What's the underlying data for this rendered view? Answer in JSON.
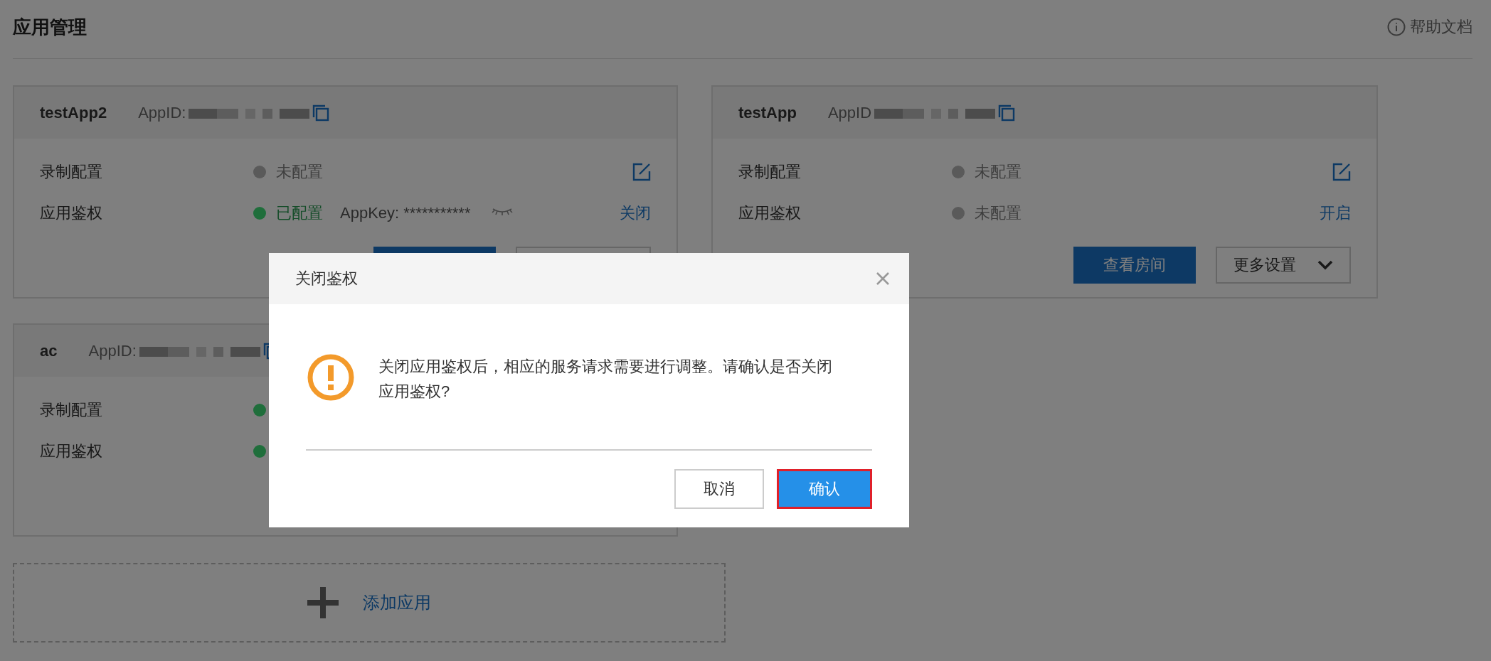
{
  "page": {
    "title": "应用管理",
    "help_link": "帮助文档"
  },
  "cards": [
    {
      "name": "testApp2",
      "appid_label": "AppID:",
      "rows": [
        {
          "label": "录制配置",
          "status": {
            "color": "#5a5a5a",
            "text": "未配置"
          },
          "action": {
            "kind": "edit"
          }
        },
        {
          "label": "应用鉴权",
          "status": {
            "color": "#1f6e3b",
            "text": "已配置"
          },
          "appkey": {
            "label": "AppKey:",
            "value": "***********"
          },
          "action": {
            "kind": "link",
            "text": "关闭"
          }
        }
      ],
      "buttons": [
        {
          "kind": "primary"
        },
        {
          "kind": "outline"
        }
      ]
    },
    {
      "name": "testApp",
      "appid_label": "AppID",
      "rows": [
        {
          "label": "录制配置",
          "status": {
            "color": "#5a5a5a",
            "text": "未配置"
          },
          "action": {
            "kind": "edit"
          }
        },
        {
          "label": "应用鉴权",
          "status": {
            "color": "#5a5a5a",
            "text": "未配置"
          },
          "action": {
            "kind": "link",
            "text": "开启"
          }
        }
      ],
      "buttons": [
        {
          "kind": "primary",
          "label": "查看房间"
        },
        {
          "kind": "outline",
          "label": "更多设置"
        }
      ]
    },
    {
      "name": "ac",
      "appid_label": "AppID:",
      "rows": [
        {
          "label": "录制配置",
          "status": {
            "color": "#1f6e3b"
          }
        },
        {
          "label": "应用鉴权",
          "status": {
            "color": "#1f6e3b"
          }
        }
      ]
    }
  ],
  "add_app": {
    "label": "添加应用"
  },
  "dialog": {
    "title": "关闭鉴权",
    "message": "关闭应用鉴权后，相应的服务请求需要进行调整。请确认是否关闭应用鉴权?",
    "buttons": [
      {
        "kind": "cancel",
        "label": "取消"
      },
      {
        "kind": "confirm",
        "label": "确认"
      }
    ]
  }
}
